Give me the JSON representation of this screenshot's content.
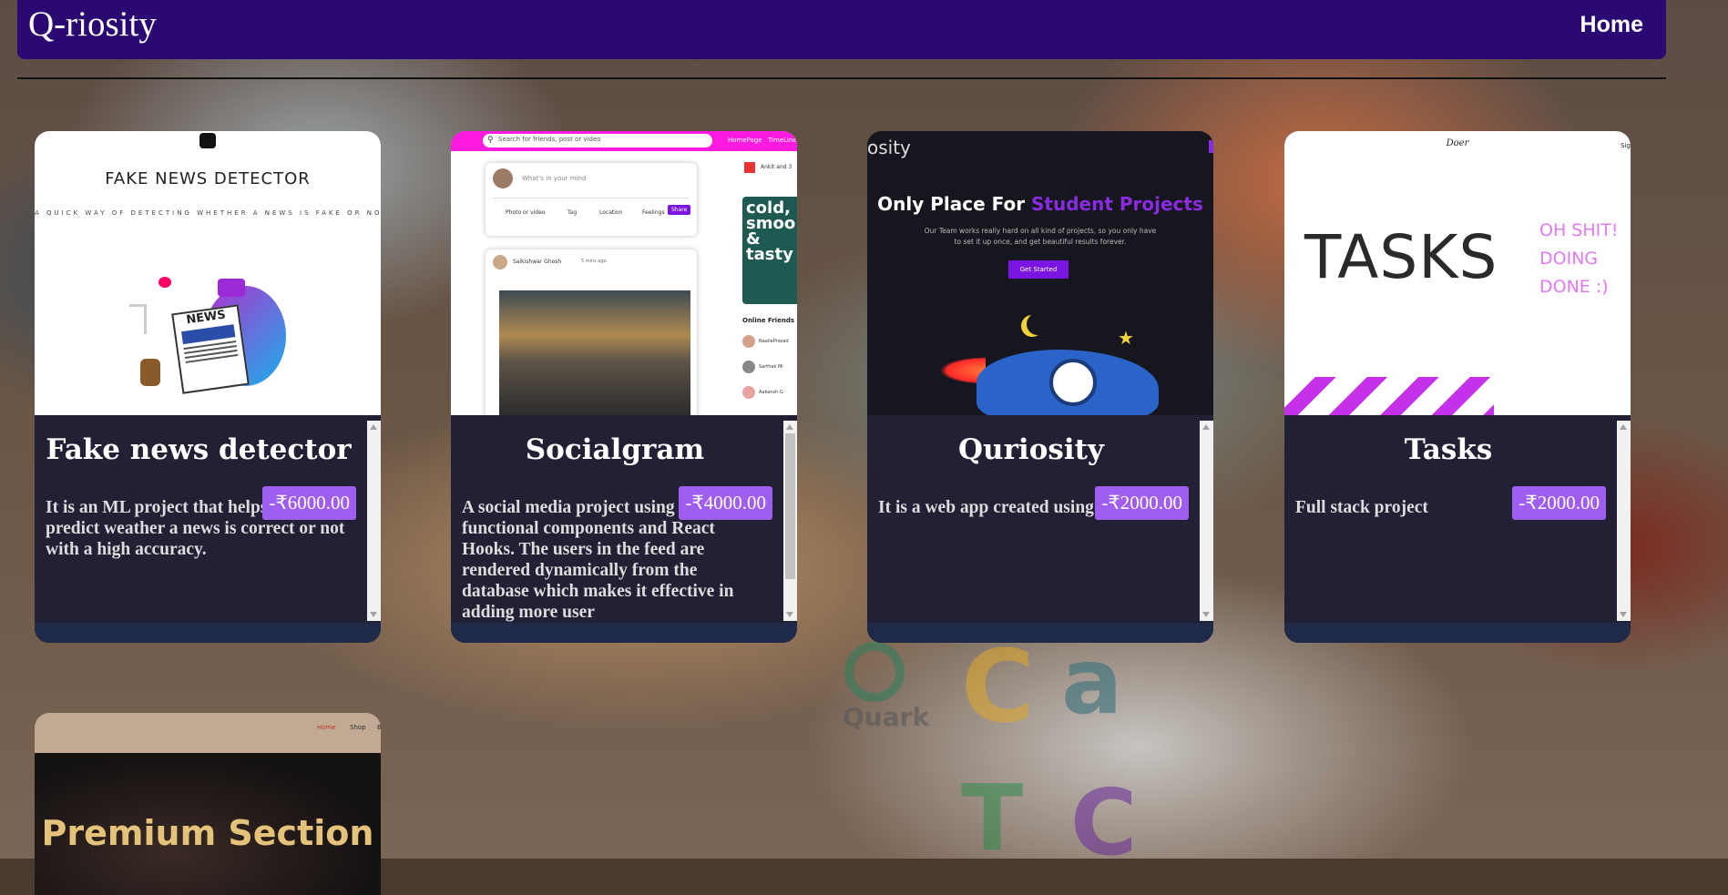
{
  "brand": "Q-riosity",
  "nav": {
    "home": "Home"
  },
  "cards": [
    {
      "title": "Fake news detector",
      "price": "-₹6000.00",
      "description": "It is an ML project that helps us predict weather a news is correct or not with a high accuracy.",
      "thumb": {
        "heading": "FAKE NEWS DETECTOR",
        "subheading": "A QUICK WAY OF DETECTING WHETHER A NEWS IS FAKE OR NOT",
        "badge": "NEWS"
      }
    },
    {
      "title": "Socialgram",
      "price": "-₹4000.00",
      "description": "A social media project using React functional components and React Hooks. The users in the feed are rendered dynamically from the database which makes it effective in adding more user",
      "thumb": {
        "search_placeholder": "Search for friends, post or video",
        "nav_home": "HomePage",
        "nav_timeline": "TimeLine",
        "whats_on_mind": "What's in your mind",
        "photo": "Photo or video",
        "tag": "Tag",
        "location": "Location",
        "feelings": "Feelings",
        "share": "Share",
        "post_author": "Saikishwar Ghosh",
        "post_time": "5 mins ago",
        "birthday": "Ankit and 3",
        "ad_text": "cold, smoo & tasty",
        "online_friends": "Online Friends",
        "friends": [
          "NaaliePrasad",
          "Sarthak Mi",
          "Aakansh G"
        ]
      }
    },
    {
      "title": "Quriosity",
      "price": "-₹2000.00",
      "description": "It is a web app created using react js.",
      "thumb": {
        "logo_fragment": "osity",
        "heading_plain": "Only Place For ",
        "heading_accent": "Student Projects",
        "tagline": "Our Team works really hard on all kind of projects, so you only have to set it up once, and get beautiful results forever.",
        "cta": "Get Started"
      }
    },
    {
      "title": "Tasks",
      "price": "-₹2000.00",
      "description": "Full stack project",
      "thumb": {
        "logo": "Doer",
        "heading": "TASKS",
        "side_text": [
          "OH SHIT!",
          "DOING",
          "DONE :)"
        ],
        "corner": "Sig"
      }
    }
  ],
  "premium": {
    "heading": "Premium Section",
    "nav": [
      "Home",
      "Shop",
      "B"
    ]
  },
  "bg_logos": [
    "Quark",
    "C",
    "a",
    "T",
    "C"
  ],
  "colors": {
    "navbar": "#2a0a72",
    "price_badge": "#a05ef0",
    "card_body": "#222034",
    "accent_purple": "#8a2be2"
  }
}
